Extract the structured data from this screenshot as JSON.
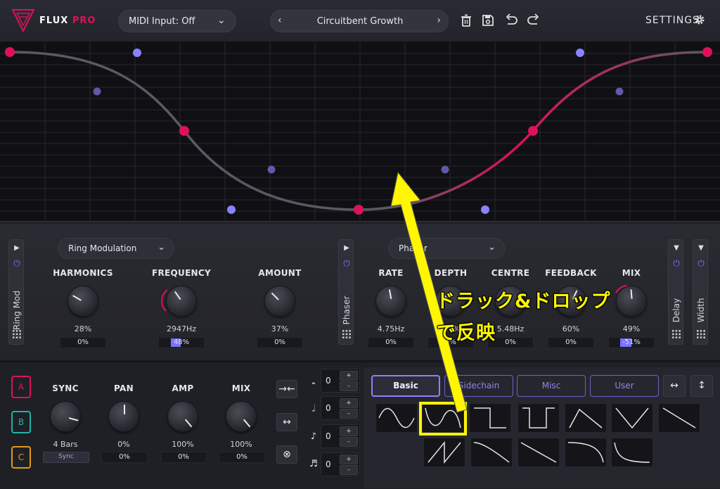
{
  "header": {
    "logo_text": "FLUX",
    "logo_suffix": "PRO",
    "midi_input": "MIDI Input: Off",
    "preset_name": "Circuitbent Growth",
    "settings_label": "SETTINGS",
    "icons": [
      "trash-icon",
      "save-icon",
      "undo-icon",
      "redo-icon",
      "gear-icon"
    ]
  },
  "fx": {
    "ringmod": {
      "strip_label": "Ring Mod",
      "dropdown": "Ring Modulation",
      "params": [
        {
          "label": "HARMONICS",
          "value": "28%",
          "mod": "0%"
        },
        {
          "label": "FREQUENCY",
          "value": "2947Hz",
          "mod": "48%"
        },
        {
          "label": "AMOUNT",
          "value": "37%",
          "mod": "0%"
        }
      ]
    },
    "phaser": {
      "strip_label": "Phaser",
      "dropdown": "Phaser",
      "params": [
        {
          "label": "RATE",
          "value": "4.75Hz",
          "mod": "0%"
        },
        {
          "label": "DEPTH",
          "value": "4.4%",
          "mod": "0%"
        },
        {
          "label": "CENTRE",
          "value": "5.48Hz",
          "mod": "0%"
        },
        {
          "label": "FEEDBACK",
          "value": "60%",
          "mod": "0%"
        },
        {
          "label": "MIX",
          "value": "49%",
          "mod": "-51%"
        }
      ]
    },
    "delay_label": "Delay",
    "width_label": "Width"
  },
  "lfo": {
    "slots": [
      "A",
      "B",
      "C"
    ],
    "slot_colors": [
      "#e0105a",
      "#1fb3a4",
      "#e09a1a"
    ],
    "params": [
      {
        "label": "SYNC",
        "value": "4 Bars",
        "mod": "Sync"
      },
      {
        "label": "PAN",
        "value": "0%",
        "mod": "0%"
      },
      {
        "label": "AMP",
        "value": "100%",
        "mod": "0%"
      },
      {
        "label": "MIX",
        "value": "100%",
        "mod": "0%"
      }
    ],
    "steppers": [
      "0",
      "0",
      "0",
      "0"
    ],
    "plus": "+",
    "minus": "-"
  },
  "shape_panel": {
    "tabs": [
      "Basic",
      "Sidechain",
      "Misc",
      "User"
    ],
    "active_tab": "Basic",
    "shapes_row1": [
      "sine",
      "inverted-sine",
      "square",
      "inverted-square",
      "triangle",
      "inverted-triangle",
      "saw-down"
    ],
    "shapes_row2": [
      "saw-up",
      "exp-down",
      "saw-down-2",
      "log-down",
      "exp-decay"
    ]
  },
  "annotation": {
    "line1": "ドラック&ドロップ",
    "line2": "で反映",
    "highlight_color": "#fff600"
  },
  "colors": {
    "accent_pink": "#e0105a",
    "accent_purple": "#8a82ff"
  }
}
